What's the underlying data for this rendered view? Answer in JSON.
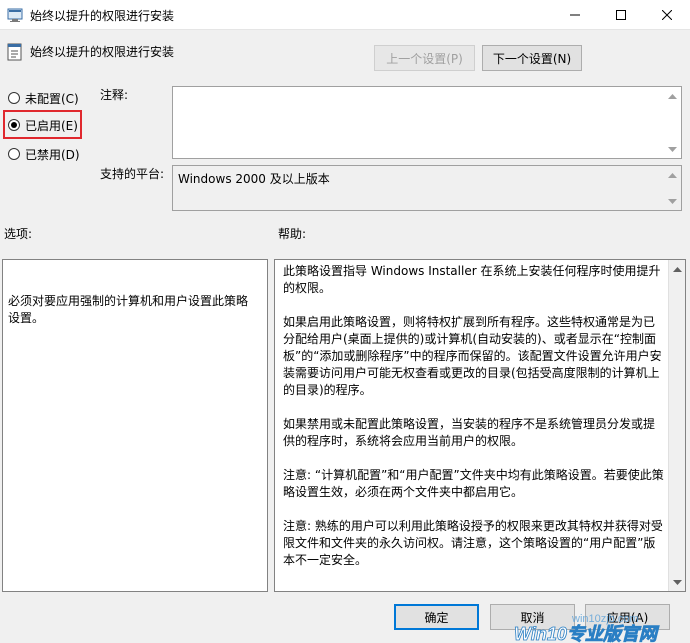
{
  "window": {
    "title": "始终以提升的权限进行安装",
    "controls": [
      "minimize-icon",
      "maximize-icon",
      "close-icon"
    ]
  },
  "header": {
    "title": "始终以提升的权限进行安装",
    "prev_label": "上一个设置(P)",
    "next_label": "下一个设置(N)"
  },
  "state": {
    "options": [
      {
        "label": "未配置(C)",
        "checked": false
      },
      {
        "label": "已启用(E)",
        "checked": true
      },
      {
        "label": "已禁用(D)",
        "checked": false
      }
    ]
  },
  "comment": {
    "label": "注释:",
    "value": ""
  },
  "platform": {
    "label": "支持的平台:",
    "value": "Windows 2000 及以上版本"
  },
  "options_section": {
    "label": "选项:",
    "text": "必须对要应用强制的计算机和用户设置此策略设置。"
  },
  "help_section": {
    "label": "帮助:",
    "paragraphs": [
      "此策略设置指导 Windows Installer 在系统上安装任何程序时使用提升的权限。",
      "如果启用此策略设置，则将特权扩展到所有程序。这些特权通常是为已分配给用户(桌面上提供的)或计算机(自动安装的)、或者显示在“控制面板”的“添加或删除程序”中的程序而保留的。该配置文件设置允许用户安装需要访问用户可能无权查看或更改的目录(包括受高度限制的计算机上的目录)的程序。",
      "如果禁用或未配置此策略设置，当安装的程序不是系统管理员分发或提供的程序时，系统将会应用当前用户的权限。",
      "注意: “计算机配置”和“用户配置”文件夹中均有此策略设置。若要使此策略设置生效，必须在两个文件夹中都启用它。",
      "注意: 熟练的用户可以利用此策略设授予的权限来更改其特权并获得对受限文件和文件夹的永久访问权。请注意，这个策略设置的“用户配置”版本不一定安全。"
    ]
  },
  "footer": {
    "ok_label": "确定",
    "cancel_label": "取消",
    "apply_label": "应用(A)"
  },
  "watermark": {
    "site": "win10zjb.com",
    "brand": "Win10专业版官网"
  },
  "colors": {
    "highlight": "#e0282e",
    "primary_border": "#0078d7",
    "window_bg": "#f0f0f0"
  }
}
